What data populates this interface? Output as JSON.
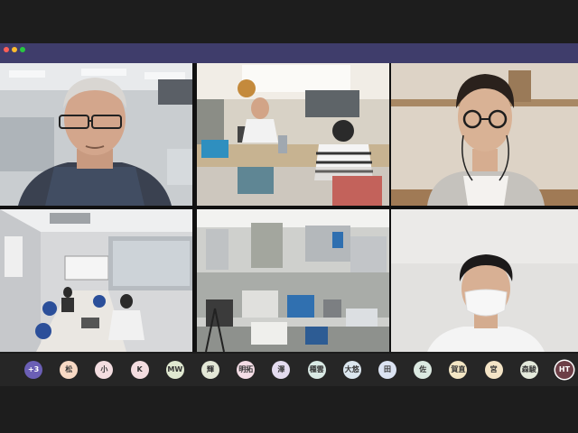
{
  "colors": {
    "titlebar": "#3f3d6b",
    "traffic_red": "#ff5f57",
    "traffic_yellow": "#febc2e",
    "traffic_green": "#28c840",
    "overflow_avatar": "#6b5fb5",
    "active_avatar": "#6d3f47"
  },
  "participants": [
    {
      "label": "+3",
      "color": "#6b5fb5"
    },
    {
      "label": "松",
      "color": "#f7d9c4"
    },
    {
      "label": "小",
      "color": "#f3dde0"
    },
    {
      "label": "K",
      "color": "#f3dde0"
    },
    {
      "label": "MW",
      "color": "#dfe8d0"
    },
    {
      "label": "輝",
      "color": "#e3e7d6"
    },
    {
      "label": "明拓",
      "color": "#f4dde6"
    },
    {
      "label": "澤",
      "color": "#e4dcef"
    },
    {
      "label": "種雲",
      "color": "#d9e9e4"
    },
    {
      "label": "大悠",
      "color": "#dbe6ee"
    },
    {
      "label": "田",
      "color": "#dbe3f2"
    },
    {
      "label": "佐",
      "color": "#dbe9e1"
    },
    {
      "label": "賀直",
      "color": "#f3e6c4"
    },
    {
      "label": "宮",
      "color": "#f4e4c6"
    },
    {
      "label": "森駿",
      "color": "#e4eadc"
    },
    {
      "label": "HT",
      "color": "#6d3f47"
    }
  ],
  "video_tiles": [
    {
      "name": "video-tile-older-man-office"
    },
    {
      "name": "video-tile-open-office-desk"
    },
    {
      "name": "video-tile-man-with-glasses"
    },
    {
      "name": "video-tile-meeting-room"
    },
    {
      "name": "video-tile-cluttered-lab"
    },
    {
      "name": "video-tile-man-with-mask"
    }
  ]
}
